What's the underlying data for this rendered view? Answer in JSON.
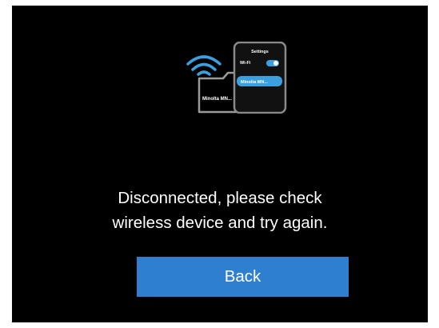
{
  "illustration": {
    "phone_title": "Settings",
    "wifi_label": "Wi-Fi",
    "wifi_toggle_on": true,
    "selected_device": "Minolta MN...",
    "camera_label": "Minolta MN...",
    "wifi_icon": "wifi-icon",
    "accent_color": "#3aa0e0"
  },
  "message": {
    "line1": "Disconnected, please check",
    "line2": "wireless device and try again."
  },
  "buttons": {
    "back_label": "Back",
    "back_color": "#2e7fd0"
  }
}
